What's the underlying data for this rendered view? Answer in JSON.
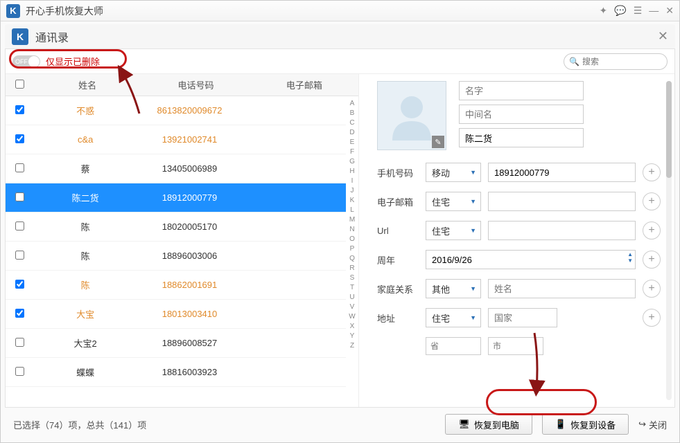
{
  "app": {
    "title": "开心手机恢复大师",
    "logo_letter": "K"
  },
  "subwindow": {
    "title": "通讯录"
  },
  "toggle": {
    "state_text": "OFF",
    "label": "仅显示已删除"
  },
  "search": {
    "placeholder": "搜索"
  },
  "table": {
    "headers": {
      "name": "姓名",
      "phone": "电话号码",
      "email": "电子邮箱"
    },
    "rows": [
      {
        "checked": true,
        "deleted": true,
        "selected": false,
        "name": "不惑",
        "phone": "8613820009672",
        "email": ""
      },
      {
        "checked": true,
        "deleted": true,
        "selected": false,
        "name": "c&a",
        "phone": "13921002741",
        "email": ""
      },
      {
        "checked": false,
        "deleted": false,
        "selected": false,
        "name": "蔡",
        "phone": "13405006989",
        "email": ""
      },
      {
        "checked": false,
        "deleted": false,
        "selected": true,
        "name": "陈二货",
        "phone": "18912000779",
        "email": ""
      },
      {
        "checked": false,
        "deleted": false,
        "selected": false,
        "name": "陈",
        "phone": "18020005170",
        "email": ""
      },
      {
        "checked": false,
        "deleted": false,
        "selected": false,
        "name": "陈",
        "phone": "18896003006",
        "email": ""
      },
      {
        "checked": true,
        "deleted": true,
        "selected": false,
        "name": "陈",
        "phone": "18862001691",
        "email": ""
      },
      {
        "checked": true,
        "deleted": true,
        "selected": false,
        "name": "大宝",
        "phone": "18013003410",
        "email": ""
      },
      {
        "checked": false,
        "deleted": false,
        "selected": false,
        "name": "大宝2",
        "phone": "18896008527",
        "email": ""
      },
      {
        "checked": false,
        "deleted": false,
        "selected": false,
        "name": "蝶蝶",
        "phone": "18816003923",
        "email": ""
      }
    ],
    "alpha": [
      "A",
      "B",
      "C",
      "D",
      "E",
      "F",
      "G",
      "H",
      "I",
      "J",
      "K",
      "L",
      "M",
      "N",
      "O",
      "P",
      "Q",
      "R",
      "S",
      "T",
      "U",
      "V",
      "W",
      "X",
      "Y",
      "Z"
    ]
  },
  "detail": {
    "first_name_placeholder": "名字",
    "middle_name_placeholder": "中间名",
    "last_name_value": "陈二货",
    "fields": {
      "phone_label": "手机号码",
      "phone_type": "移动",
      "phone_value": "18912000779",
      "email_label": "电子邮箱",
      "email_type": "住宅",
      "url_label": "Url",
      "url_type": "住宅",
      "anniv_label": "周年",
      "anniv_value": "2016/9/26",
      "family_label": "家庭关系",
      "family_type": "其他",
      "family_name_placeholder": "姓名",
      "addr_label": "地址",
      "addr_type": "住宅",
      "addr_country_placeholder": "国家",
      "addr_province_placeholder": "省",
      "addr_city_placeholder": "市"
    }
  },
  "footer": {
    "status_prefix": "已选择（",
    "selected_count": "74",
    "status_mid": "）项，总共（",
    "total_count": "141",
    "status_suffix": "）项",
    "btn_restore_pc": "恢复到电脑",
    "btn_restore_device": "恢复到设备",
    "btn_close": "关闭"
  }
}
